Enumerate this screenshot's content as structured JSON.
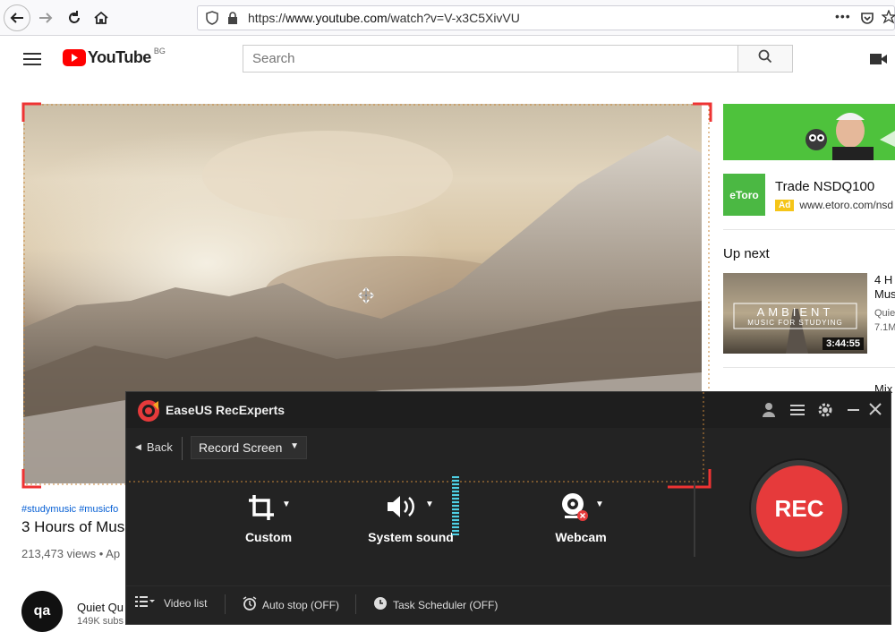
{
  "browser": {
    "url_prefix": "https://",
    "url_host": "www.youtube.com",
    "url_path": "/watch?v=V-x3C5XivVU",
    "more_icon": "•••"
  },
  "youtube": {
    "logo_text": "YouTube",
    "region": "BG",
    "search_placeholder": "Search"
  },
  "video": {
    "hashtags": "#studymusic #musicfo",
    "title": "3 Hours of Mus",
    "views": "213,473 views • Ap",
    "channel_name": "Quiet Qu",
    "channel_subs": "149K subs"
  },
  "sidebar": {
    "ad_title": "Trade NSDQ100",
    "ad_badge": "Ad",
    "ad_url": "www.etoro.com/nsd",
    "ad_logo": "eToro",
    "up_next": "Up next",
    "next_video": {
      "title": "4 H",
      "title2": "Mus",
      "channel": "Quie",
      "views": "7.1M",
      "duration": "3:44:55",
      "thumb_title": "AMBIENT",
      "thumb_subtitle": "MUSIC FOR STUDYING"
    },
    "next_video2_title": "Mix"
  },
  "recorder": {
    "app_name": "EaseUS RecExperts",
    "back_label": "Back",
    "mode_label": "Record Screen",
    "tools": [
      {
        "label": "Custom",
        "icon": "crop-icon"
      },
      {
        "label": "System sound",
        "icon": "speaker-icon"
      },
      {
        "label": "Webcam",
        "icon": "webcam-icon"
      }
    ],
    "rec_label": "REC",
    "video_list": "Video list",
    "auto_stop": "Auto stop (OFF)",
    "task_scheduler": "Task Scheduler (OFF)",
    "accent_color": "#e63a3b"
  }
}
